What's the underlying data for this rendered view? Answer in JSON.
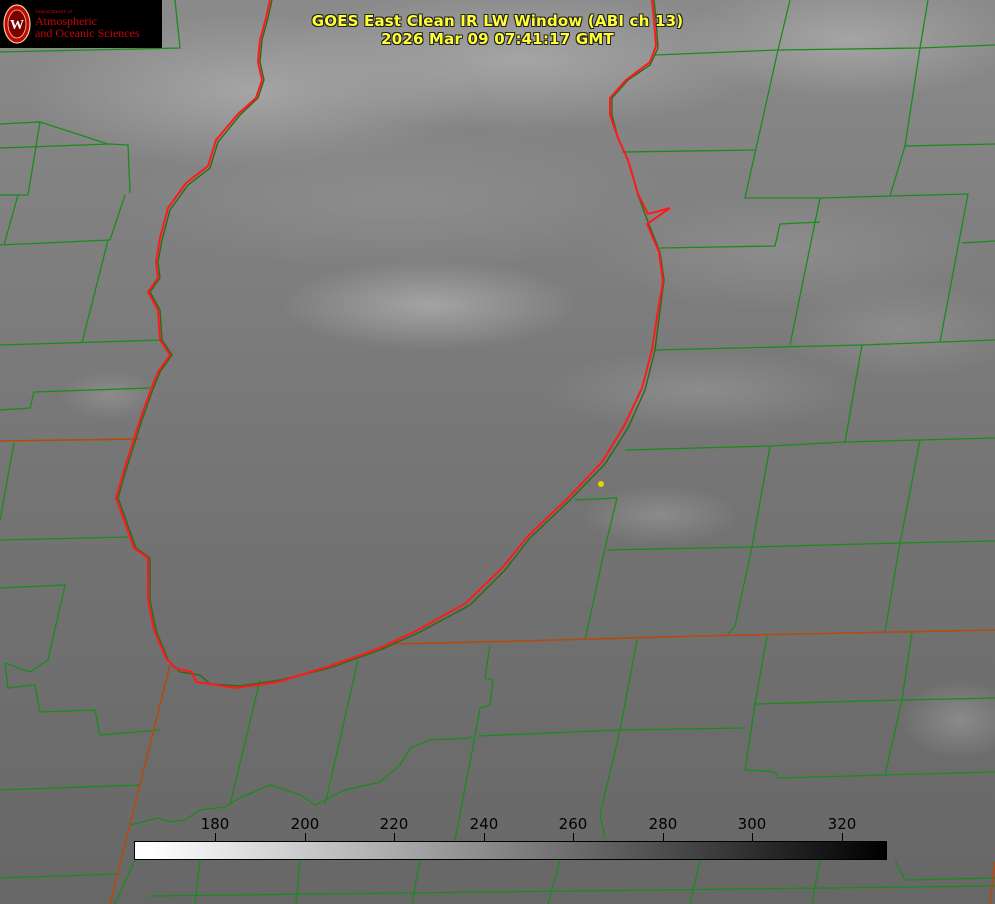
{
  "logo": {
    "line1": "Department of",
    "line2": "Atmospheric",
    "line3": "and Oceanic Sciences",
    "brand_color": "#c5050c"
  },
  "header": {
    "title": "GOES East Clean IR LW Window (ABI ch 13)",
    "timestamp": "2026 Mar 09 07:41:17 GMT"
  },
  "colorbar": {
    "ticks": [
      "180",
      "200",
      "220",
      "240",
      "260",
      "280",
      "300",
      "320"
    ],
    "min_color": "#ffffff",
    "max_color": "#000000"
  },
  "map": {
    "lake_outline_color": "#ff1a1a",
    "county_line_color": "#1a8c1a",
    "state_line_color": "#cc4400",
    "marker_color": "#ffee00"
  }
}
